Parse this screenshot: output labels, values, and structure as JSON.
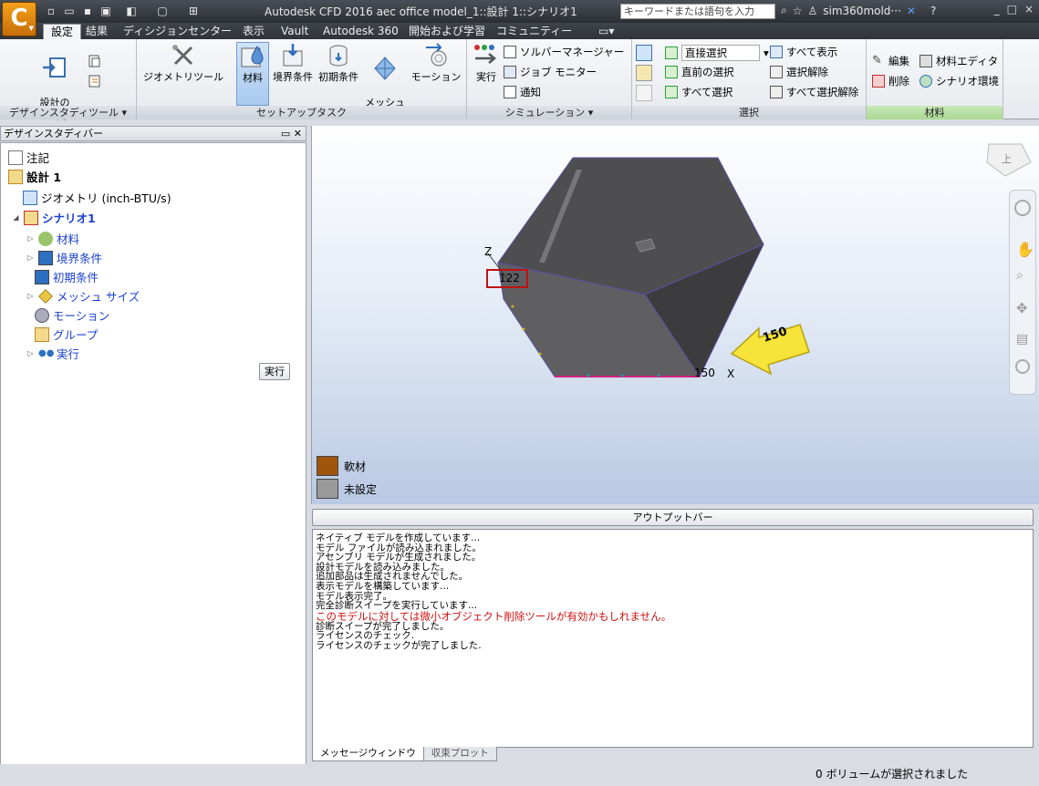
{
  "titlebar": {
    "app_label": "C",
    "title": "Autodesk CFD 2016   aec office model_1::設計 1::シナリオ1",
    "search_placeholder": "キーワードまたは語句を入力",
    "user": "sim360mold···"
  },
  "tabs": [
    "設定",
    "結果",
    "ディシジョンセンター",
    "表示",
    "Vault",
    "Autodesk 360",
    "開始および学習",
    "コミュニティー"
  ],
  "ribbon": {
    "design_tools": {
      "add_update": "設計の\n追加/更新",
      "title": "デザインスタディツール ▾"
    },
    "setup": {
      "geometry_tools": "ジオメトリツール",
      "materials": "材料",
      "boundary": "境界条件",
      "initial": "初期条件",
      "mesh": "メッシュ\nサイズ",
      "motion": "モーション",
      "title": "セットアップタスク"
    },
    "simulation": {
      "run": "実行",
      "solver_manager": "ソルバーマネージャー",
      "job_monitor": "ジョブ モニター",
      "notify": "通知",
      "title": "シミュレーション ▾"
    },
    "selection": {
      "mode": "直接選択",
      "previous": "直前の選択",
      "select_all": "すべて選択",
      "show_all": "すべて表示",
      "deselect": "選択解除",
      "deselect_all": "すべて選択解除",
      "title": "選択"
    },
    "materials": {
      "edit": "編集",
      "delete": "削除",
      "material_editor": "材料エディタ",
      "scenario_env": "シナリオ環境",
      "title": "材料"
    }
  },
  "design_study_bar": {
    "title": "デザインスタディバー",
    "items": {
      "notes": "注記",
      "design": "設計 1",
      "geometry": "ジオメトリ (inch-BTU/s)",
      "scenario": "シナリオ1",
      "materials": "材料",
      "boundary": "境界条件",
      "initial": "初期条件",
      "mesh": "メッシュ サイズ",
      "motion": "モーション",
      "groups": "グループ",
      "run": "実行"
    },
    "run_button": "実行"
  },
  "viewport": {
    "axis_z": "Z",
    "axis_x": "X",
    "dim_z": "122",
    "dim_x": "150",
    "arrow_label": "150",
    "viewcube_label": "上",
    "legend": [
      {
        "label": "軟材",
        "color": "#a0550d"
      },
      {
        "label": "未設定",
        "color": "#9a9a9a"
      }
    ]
  },
  "output": {
    "button": "アウトプットバー",
    "lines": [
      "ネイティブ モデルを作成しています...",
      "モデル ファイルが読み込まれました。",
      "アセンブリ モデルが生成されました。",
      "設計モデルを読み込みました。",
      "追加部品は生成されませんでした。",
      "表示モデルを構築しています...",
      "モデル表示完了。",
      "完全診断スイープを実行しています..."
    ],
    "warning": "このモデルに対しては微小オブジェクト削除ツールが有効かもしれません。",
    "lines_after": [
      "診断スイープが完了しました。",
      "ライセンスのチェック.",
      "ライセンスのチェックが完了しました."
    ],
    "tabs": [
      "メッセージウィンドウ",
      "収束プロット"
    ]
  },
  "status": "0 ボリュームが選択されました"
}
